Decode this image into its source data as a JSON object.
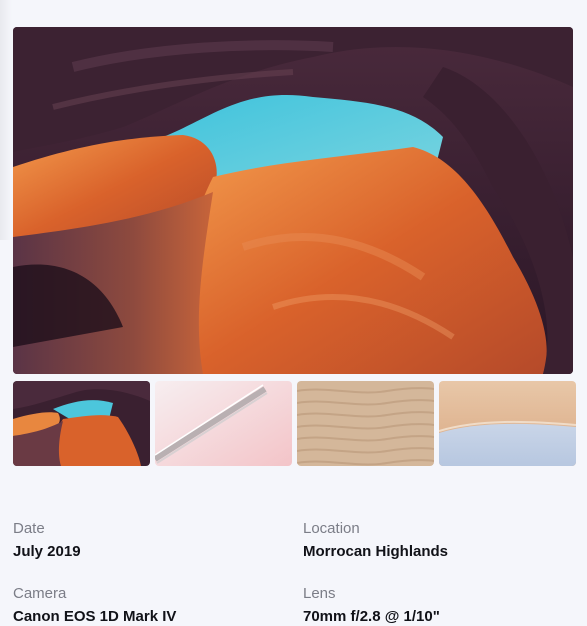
{
  "gallery": {
    "hero_image": "canyon-photo",
    "thumbnails": [
      {
        "name": "canyon-photo"
      },
      {
        "name": "pink-stairs-photo"
      },
      {
        "name": "sand-ripples-photo"
      },
      {
        "name": "desert-dune-photo"
      }
    ]
  },
  "details": {
    "date_label": "Date",
    "date_value": "July 2019",
    "location_label": "Location",
    "location_value": "Morrocan Highlands",
    "camera_label": "Camera",
    "camera_value": "Canon EOS 1D Mark IV",
    "lens_label": "Lens",
    "lens_value": "70mm f/2.8 @ 1/10\""
  },
  "colors": {
    "background": "#f5f6fb",
    "label": "#7b7d87",
    "value": "#111218"
  }
}
